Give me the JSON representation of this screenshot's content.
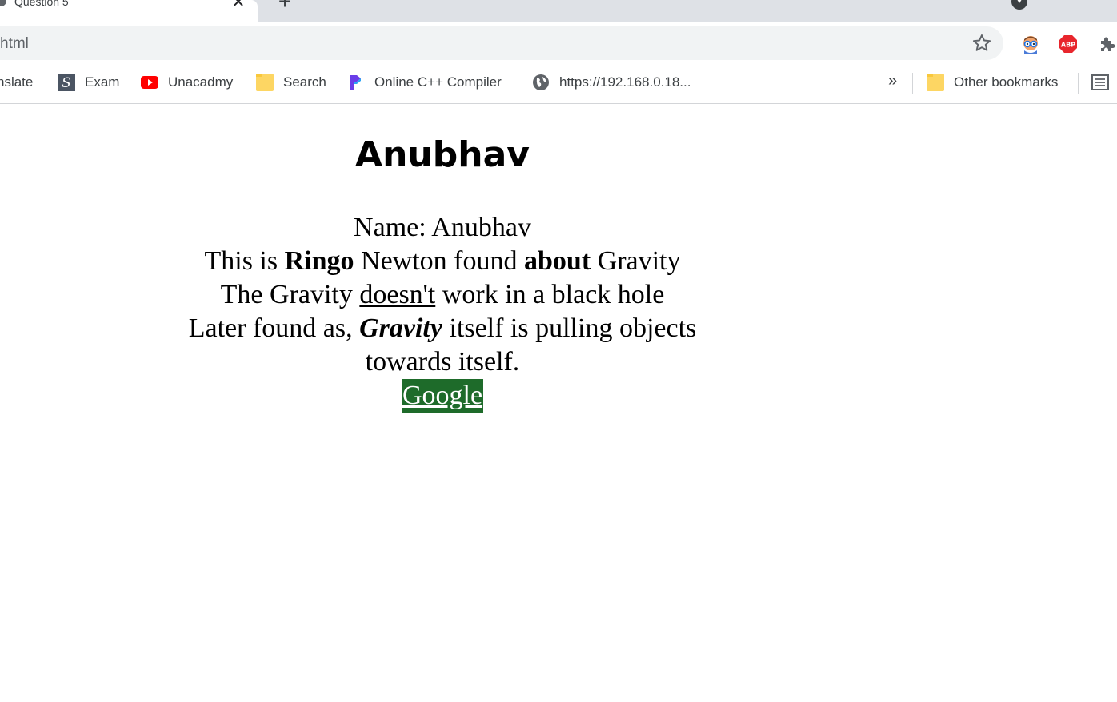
{
  "tab": {
    "title": "Question 5"
  },
  "address_bar": {
    "url": "html"
  },
  "bookmarks": {
    "items": [
      {
        "label": "nslate",
        "icon": "translate-icon"
      },
      {
        "label": "Exam",
        "icon": "exam-s-icon"
      },
      {
        "label": "Unacadmy",
        "icon": "youtube-icon"
      },
      {
        "label": "Search",
        "icon": "folder-icon"
      },
      {
        "label": "Online C++ Compiler",
        "icon": "compiler-icon"
      },
      {
        "label": "https://192.168.0.18...",
        "icon": "globe-icon"
      }
    ],
    "overflow": "»",
    "other": {
      "label": "Other bookmarks",
      "icon": "folder-icon"
    }
  },
  "extensions": [
    "glasses-icon",
    "adblock-icon",
    "extensions-puzzle-icon"
  ],
  "page": {
    "heading": "Anubhav",
    "name_line": "Name: Anubhav",
    "line2": {
      "a": "This is ",
      "b1": "Ringo",
      "c": " Newton found ",
      "b2": "about",
      "d": " Gravity"
    },
    "line3": {
      "a": "The Gravity ",
      "u": "doesn't",
      "b": " work in a black hole"
    },
    "line4": {
      "a": "Later found as, ",
      "bi": "Gravity",
      "b": " itself is pulling objects towards itself."
    },
    "link": "Google"
  },
  "colors": {
    "link_bg": "#1e6b2a",
    "tabstrip": "#dee1e6",
    "omnibox": "#f1f3f4"
  }
}
